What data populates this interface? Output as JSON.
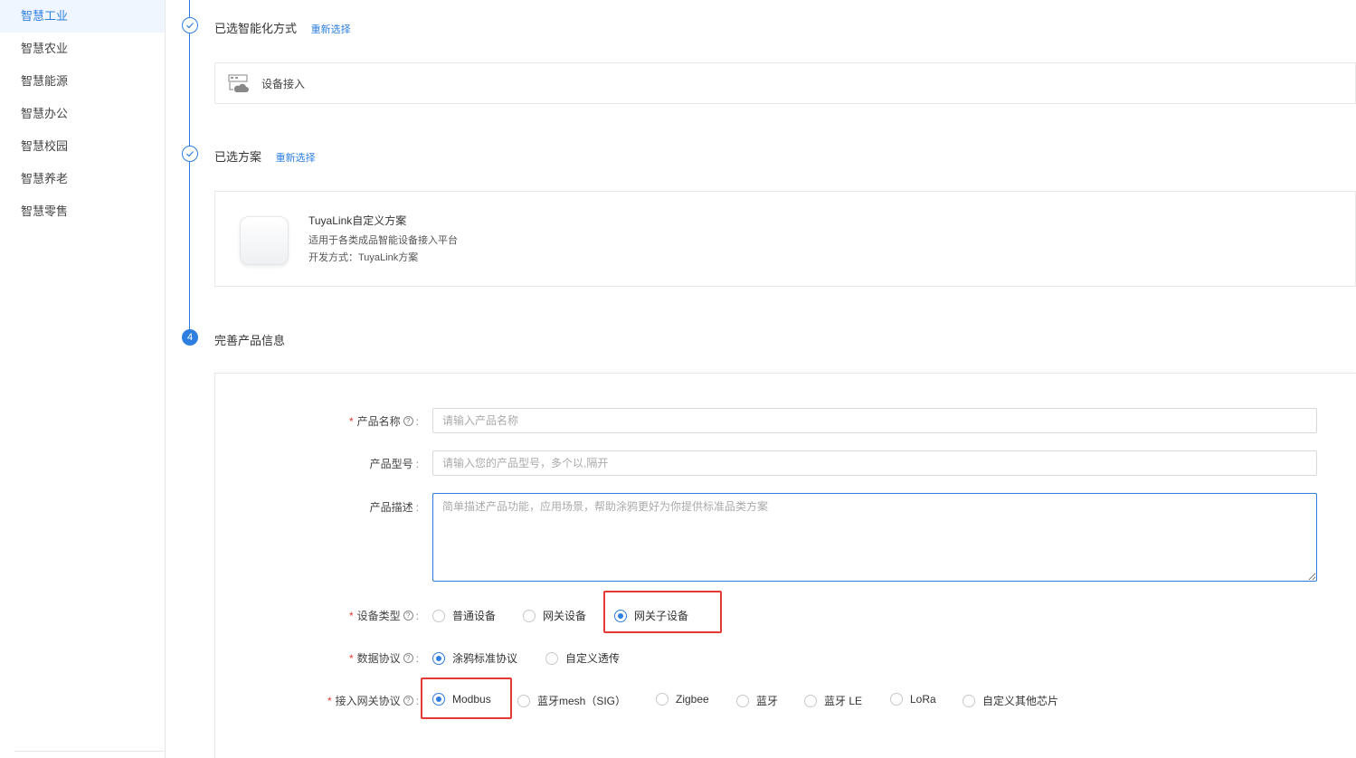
{
  "sidebar": {
    "items": [
      {
        "label": "智慧工业",
        "active": true
      },
      {
        "label": "智慧农业",
        "active": false
      },
      {
        "label": "智慧能源",
        "active": false
      },
      {
        "label": "智慧办公",
        "active": false
      },
      {
        "label": "智慧校园",
        "active": false
      },
      {
        "label": "智慧养老",
        "active": false
      },
      {
        "label": "智慧零售",
        "active": false
      }
    ]
  },
  "steps": {
    "step1": {
      "title": "已选智能化方式",
      "reselect": "重新选择",
      "selected": "设备接入"
    },
    "step2": {
      "title": "已选方案",
      "reselect": "重新选择",
      "plan_name": "TuyaLink自定义方案",
      "plan_desc": "适用于各类成品智能设备接入平台",
      "plan_dev": "开发方式：TuyaLink方案"
    },
    "step3": {
      "number": "4",
      "title": "完善产品信息"
    }
  },
  "form": {
    "product_name": {
      "label": "产品名称",
      "required": true,
      "value": "",
      "placeholder": "请输入产品名称"
    },
    "product_model": {
      "label": "产品型号",
      "required": false,
      "value": "",
      "placeholder": "请输入您的产品型号，多个以,隔开"
    },
    "product_desc": {
      "label": "产品描述",
      "required": false,
      "value": "",
      "placeholder": "简单描述产品功能，应用场景，帮助涂鸦更好为你提供标准品类方案"
    },
    "device_type": {
      "label": "设备类型",
      "required": true,
      "options": [
        "普通设备",
        "网关设备",
        "网关子设备"
      ],
      "selected": "网关子设备"
    },
    "data_protocol": {
      "label": "数据协议",
      "required": true,
      "options": [
        "涂鸦标准协议",
        "自定义透传"
      ],
      "selected": "涂鸦标准协议"
    },
    "gateway_protocol": {
      "label": "接入网关协议",
      "required": true,
      "options": [
        "Modbus",
        "蓝牙mesh（SIG）",
        "Zigbee",
        "蓝牙",
        "蓝牙 LE",
        "LoRa",
        "自定义其他芯片"
      ],
      "selected": "Modbus"
    }
  },
  "colors": {
    "accent": "#2f7fe0",
    "highlight": "#e53935"
  },
  "icons": {
    "step_done": "check-icon",
    "help": "question-circle-icon",
    "device": "cloud-device-icon"
  }
}
